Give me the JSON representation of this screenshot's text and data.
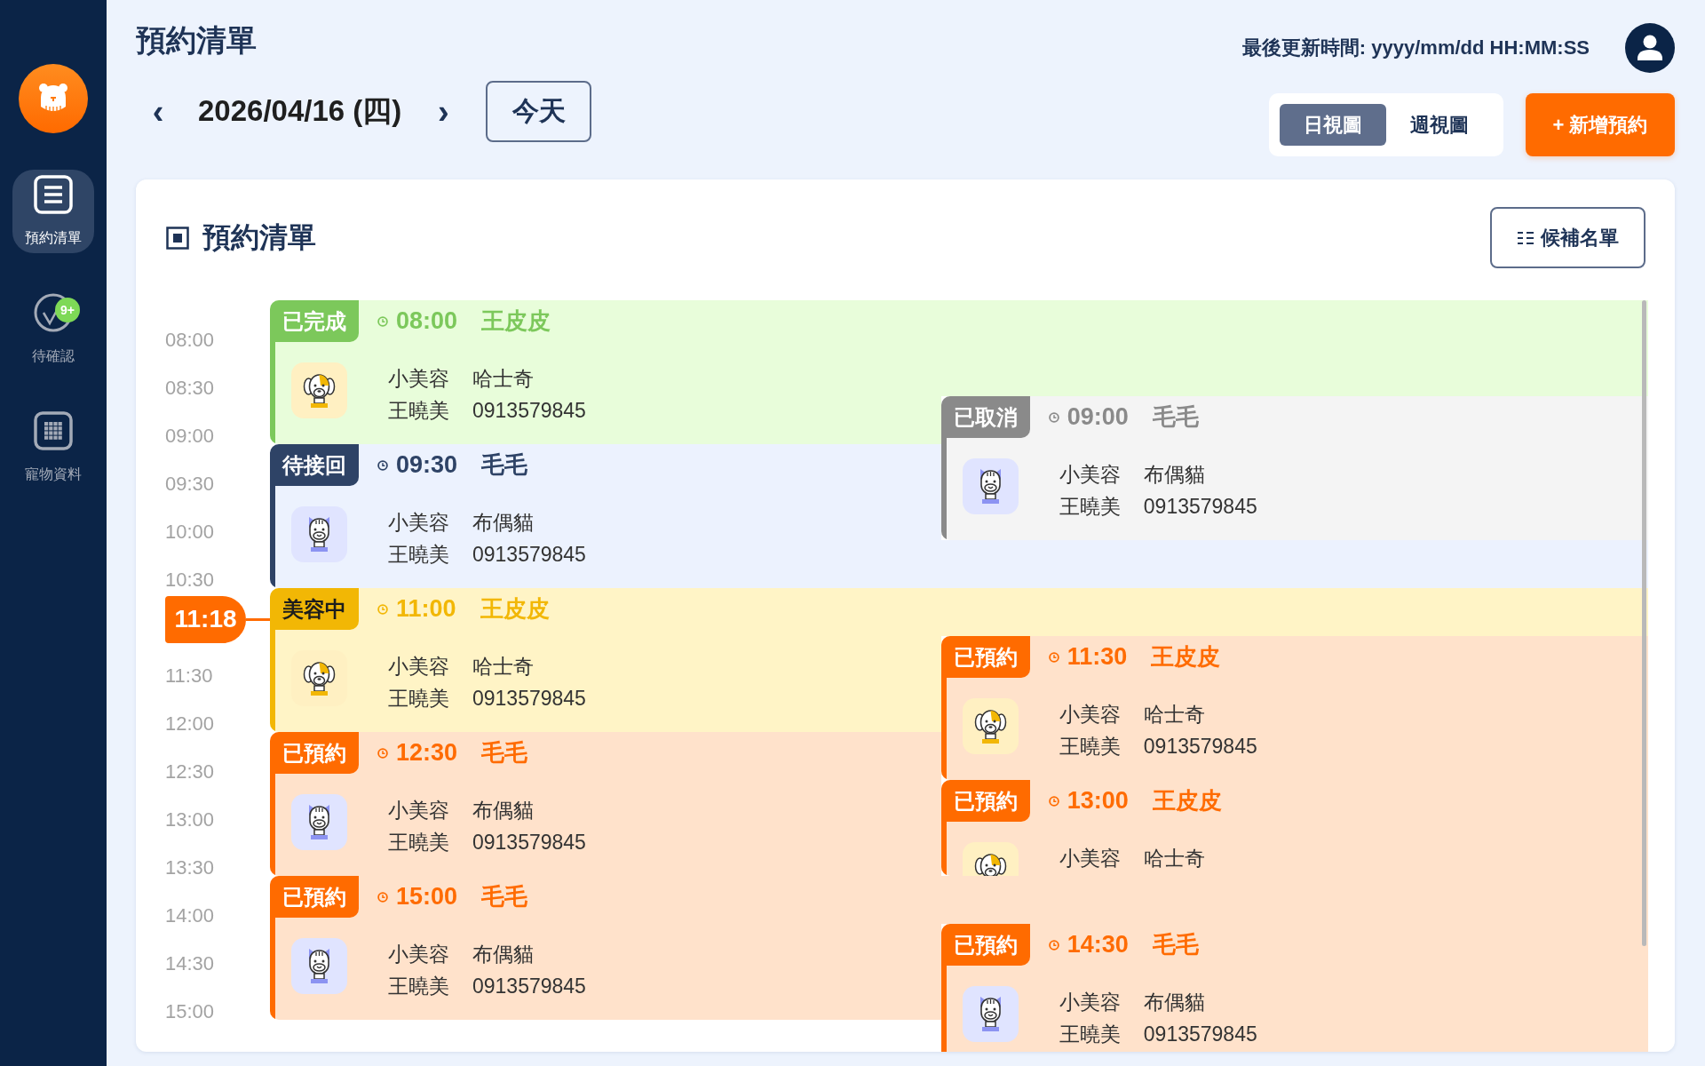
{
  "sidebar": {
    "items": [
      {
        "kind": "list",
        "label": "預約清單",
        "selected": true
      },
      {
        "kind": "check",
        "label": "待確認",
        "selected": false,
        "badge": "9+"
      },
      {
        "kind": "grid",
        "label": "寵物資料",
        "selected": false
      }
    ]
  },
  "header": {
    "title": "預約清單",
    "prev": "‹",
    "date": "2026/04/16 (四)",
    "next": "›",
    "today_button": "今天",
    "last_updated": "最後更新時間: yyyy/mm/dd HH:MM:SS",
    "view_tabs": [
      {
        "label": "日視圖",
        "selected": true
      },
      {
        "label": "週視圖",
        "selected": false
      }
    ],
    "add_button": "+ 新增預約"
  },
  "panel": {
    "title": "預約清單",
    "waitlist_button": "候補名單",
    "time_axis": [
      {
        "kind": "time",
        "label": "08:00"
      },
      {
        "kind": "time",
        "label": "08:30"
      },
      {
        "kind": "time",
        "label": "09:00"
      },
      {
        "kind": "time",
        "label": "09:30"
      },
      {
        "kind": "time",
        "label": "10:00"
      },
      {
        "kind": "time",
        "label": "10:30"
      },
      {
        "kind": "now",
        "label": "11:18"
      },
      {
        "kind": "time",
        "label": "11:30"
      },
      {
        "kind": "time",
        "label": "12:00"
      },
      {
        "kind": "time",
        "label": "12:30"
      },
      {
        "kind": "time",
        "label": "13:00"
      },
      {
        "kind": "time",
        "label": "13:30"
      },
      {
        "kind": "time",
        "label": "14:00"
      },
      {
        "kind": "time",
        "label": "14:30"
      },
      {
        "kind": "time",
        "label": "15:00"
      }
    ],
    "appointments_left": [
      {
        "kind": "completed",
        "status": "已完成",
        "color": "#7cc85b",
        "time": "08:00",
        "pet": "王皮皮",
        "avatar": {
          "kind": "dog"
        },
        "groomer": "小美容",
        "breed": "哈士奇",
        "owner": "王曉美",
        "phone": "0913579845"
      },
      {
        "kind": "pickup",
        "status": "待接回",
        "color": "#2e4366",
        "time": "09:30",
        "pet": "毛毛",
        "avatar": {
          "kind": "cat"
        },
        "groomer": "小美容",
        "breed": "布偶貓",
        "owner": "王曉美",
        "phone": "0913579845"
      },
      {
        "kind": "grooming",
        "status": "美容中",
        "color": "#f2b705",
        "time": "11:00",
        "pet": "王皮皮",
        "avatar": {
          "kind": "dog"
        },
        "groomer": "小美容",
        "breed": "哈士奇",
        "owner": "王曉美",
        "phone": "0913579845"
      },
      {
        "kind": "booked",
        "status": "已預約",
        "color": "#ff6b00",
        "time": "12:30",
        "pet": "毛毛",
        "avatar": {
          "kind": "cat"
        },
        "groomer": "小美容",
        "breed": "布偶貓",
        "owner": "王曉美",
        "phone": "0913579845"
      },
      {
        "kind": "booked",
        "status": "已預約",
        "color": "#ff6b00",
        "time": "15:00",
        "pet": "毛毛",
        "avatar": {
          "kind": "cat"
        },
        "groomer": "小美容",
        "breed": "布偶貓",
        "owner": "王曉美",
        "phone": "0913579845"
      }
    ],
    "appointments_right": [
      {
        "kind": "cancelled",
        "status": "已取消",
        "color": "#8a8a8a",
        "time": "09:00",
        "pet": "毛毛",
        "avatar": {
          "kind": "cat"
        },
        "groomer": "小美容",
        "breed": "布偶貓",
        "owner": "王曉美",
        "phone": "0913579845"
      },
      {
        "kind": "booked",
        "status": "已預約",
        "color": "#ff6b00",
        "time": "11:30",
        "pet": "王皮皮",
        "avatar": {
          "kind": "dog"
        },
        "groomer": "小美容",
        "breed": "哈士奇",
        "owner": "王曉美",
        "phone": "0913579845"
      },
      {
        "kind": "booked",
        "status": "已預約",
        "color": "#ff6b00",
        "time": "13:00",
        "pet": "王皮皮",
        "avatar": {
          "kind": "dog"
        },
        "groomer": "小美容",
        "breed": "哈士奇"
      },
      {
        "kind": "booked",
        "status": "已預約",
        "color": "#ff6b00",
        "time": "14:30",
        "pet": "毛毛",
        "avatar": {
          "kind": "cat"
        },
        "groomer": "小美容",
        "breed": "布偶貓",
        "owner": "王曉美",
        "phone": "0913579845"
      }
    ]
  }
}
